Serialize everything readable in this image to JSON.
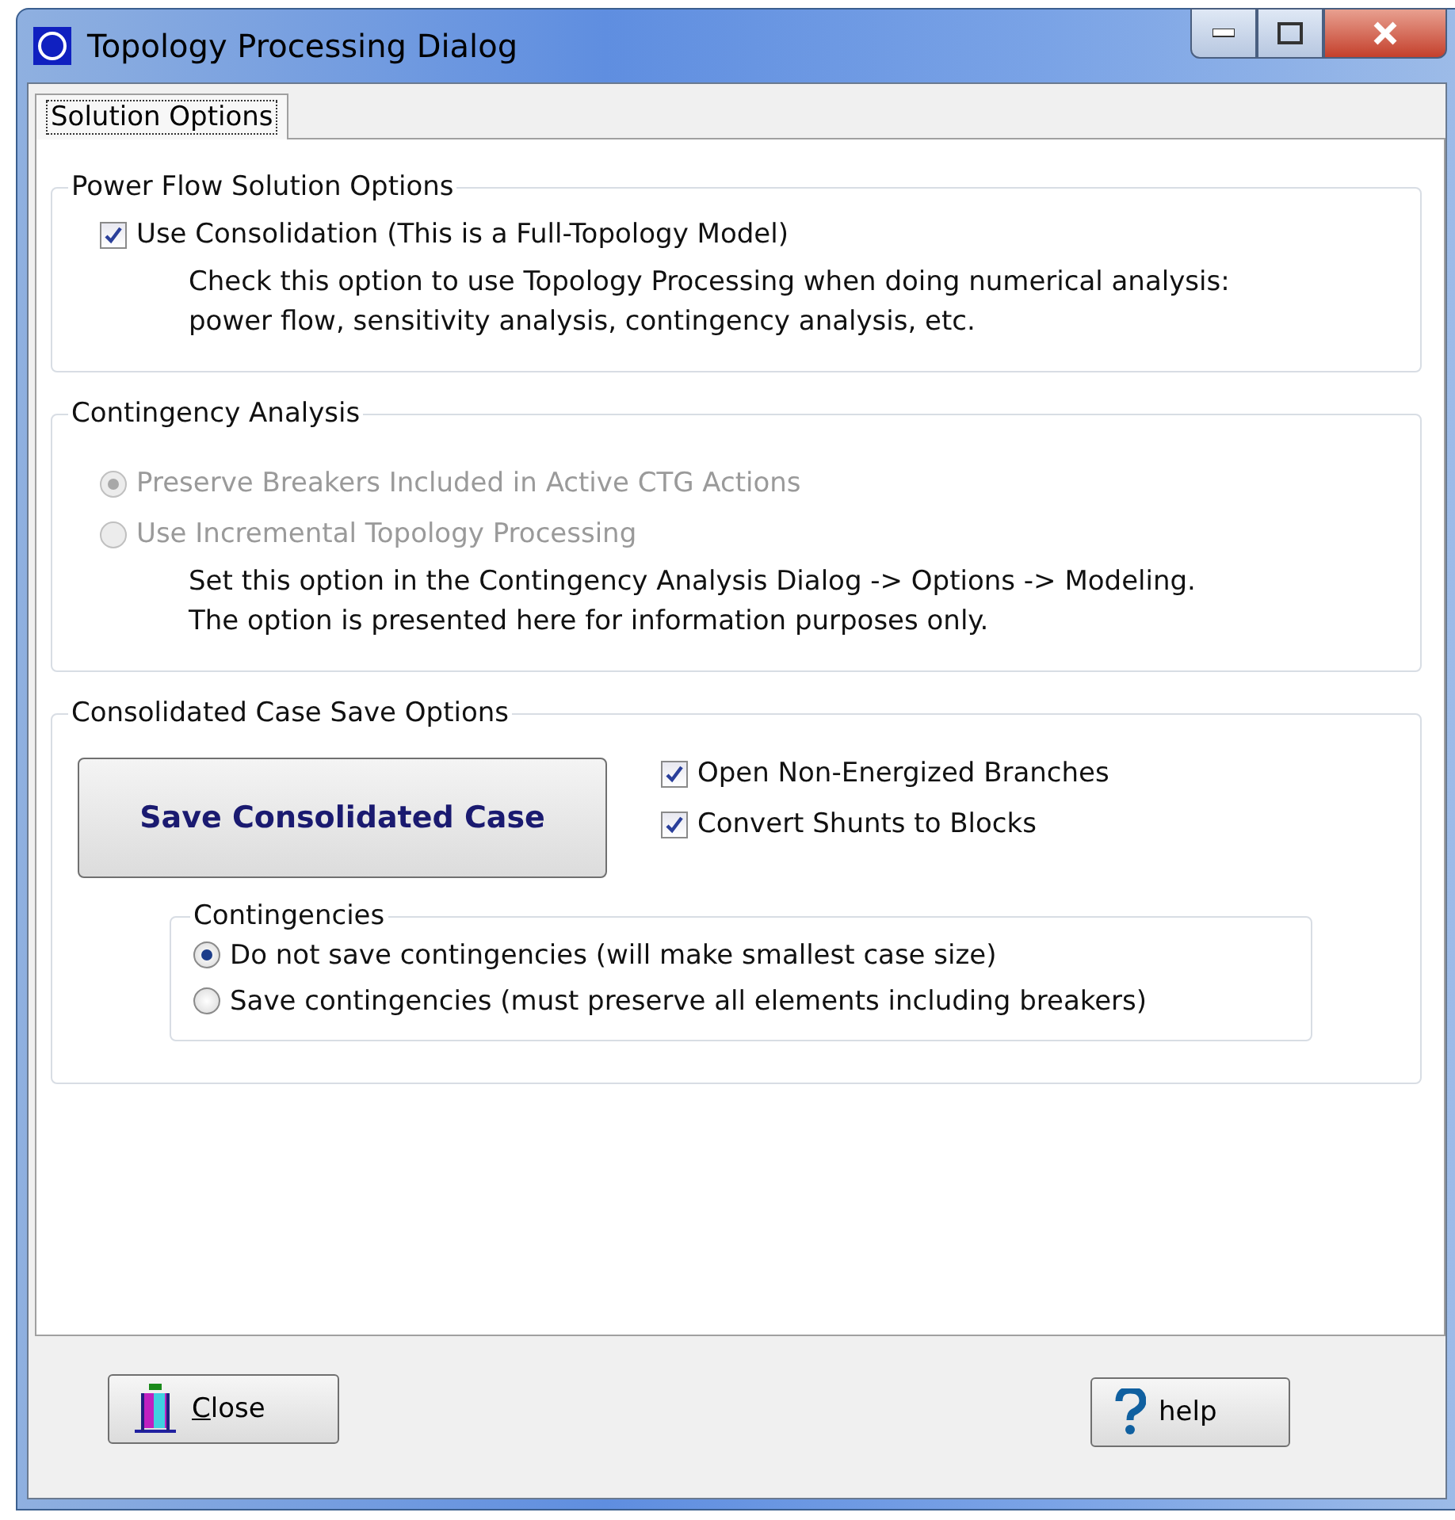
{
  "window": {
    "title": "Topology Processing Dialog"
  },
  "tabs": [
    {
      "label": "Solution Options",
      "selected": true
    }
  ],
  "power_flow": {
    "title": "Power Flow Solution Options",
    "options": [
      {
        "label": "Use Consolidation (This is a Full-Topology Model)",
        "checked": true,
        "disabled": false
      }
    ],
    "note": "Check this option to use Topology Processing when doing numerical analysis:\npower flow, sensitivity analysis, contingency analysis, etc."
  },
  "contingency_analysis": {
    "title": "Contingency Analysis",
    "options": [
      {
        "label": "Preserve Breakers Included in Active CTG Actions",
        "selected": true,
        "disabled": true
      },
      {
        "label": "Use Incremental Topology Processing",
        "selected": false,
        "disabled": true
      }
    ],
    "note": "Set this option in the Contingency Analysis Dialog -> Options -> Modeling.\nThe option is presented here for information purposes only."
  },
  "save_options": {
    "title": "Consolidated Case Save Options",
    "button": "Save Consolidated Case",
    "options": [
      {
        "label": "Open Non-Energized Branches",
        "checked": true,
        "disabled": false
      },
      {
        "label": "Convert Shunts to Blocks",
        "checked": true,
        "disabled": false
      }
    ],
    "contingencies": {
      "title": "Contingencies",
      "options": [
        {
          "label": "Do not save contingencies (will make smallest case size)",
          "selected": true,
          "disabled": false
        },
        {
          "label": "Save contingencies (must preserve all elements including breakers)",
          "selected": false,
          "disabled": false
        }
      ]
    }
  },
  "buttons": [
    {
      "kind": "close",
      "label": "Close"
    },
    {
      "kind": "help",
      "label": "help"
    }
  ]
}
